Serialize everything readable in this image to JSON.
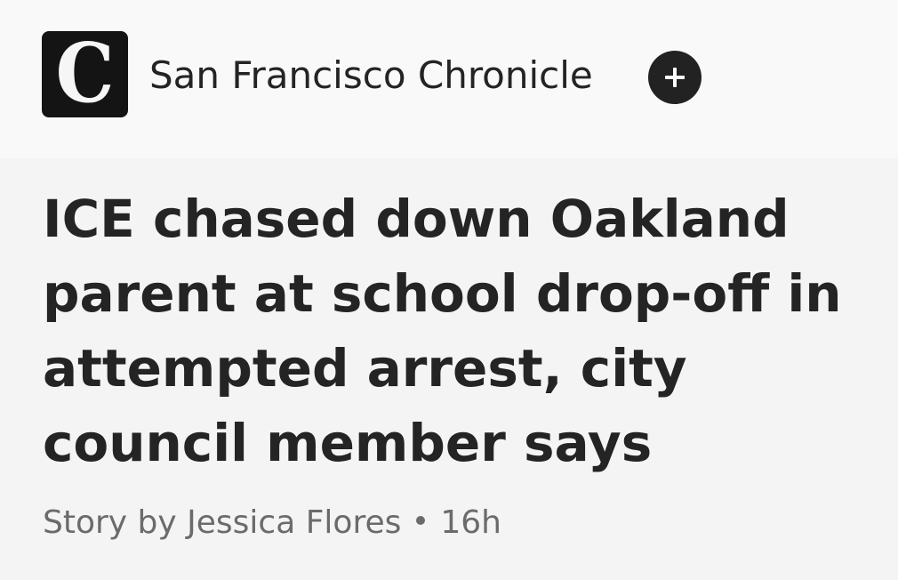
{
  "publisher": {
    "logo_letter": "C",
    "name": "San Francisco Chronicle",
    "follow_icon": "plus-icon"
  },
  "article": {
    "headline": "ICE chased down Oakland parent at school drop-off in attempted arrest, city council member says",
    "byline": "Story by Jessica Flores",
    "age": "16h"
  },
  "colors": {
    "header_bg": "#f9f9f9",
    "page_bg": "#f4f4f4",
    "logo_bg": "#141414",
    "button_bg": "#222222",
    "text": "#242424",
    "muted_text": "#6b6b6b"
  }
}
